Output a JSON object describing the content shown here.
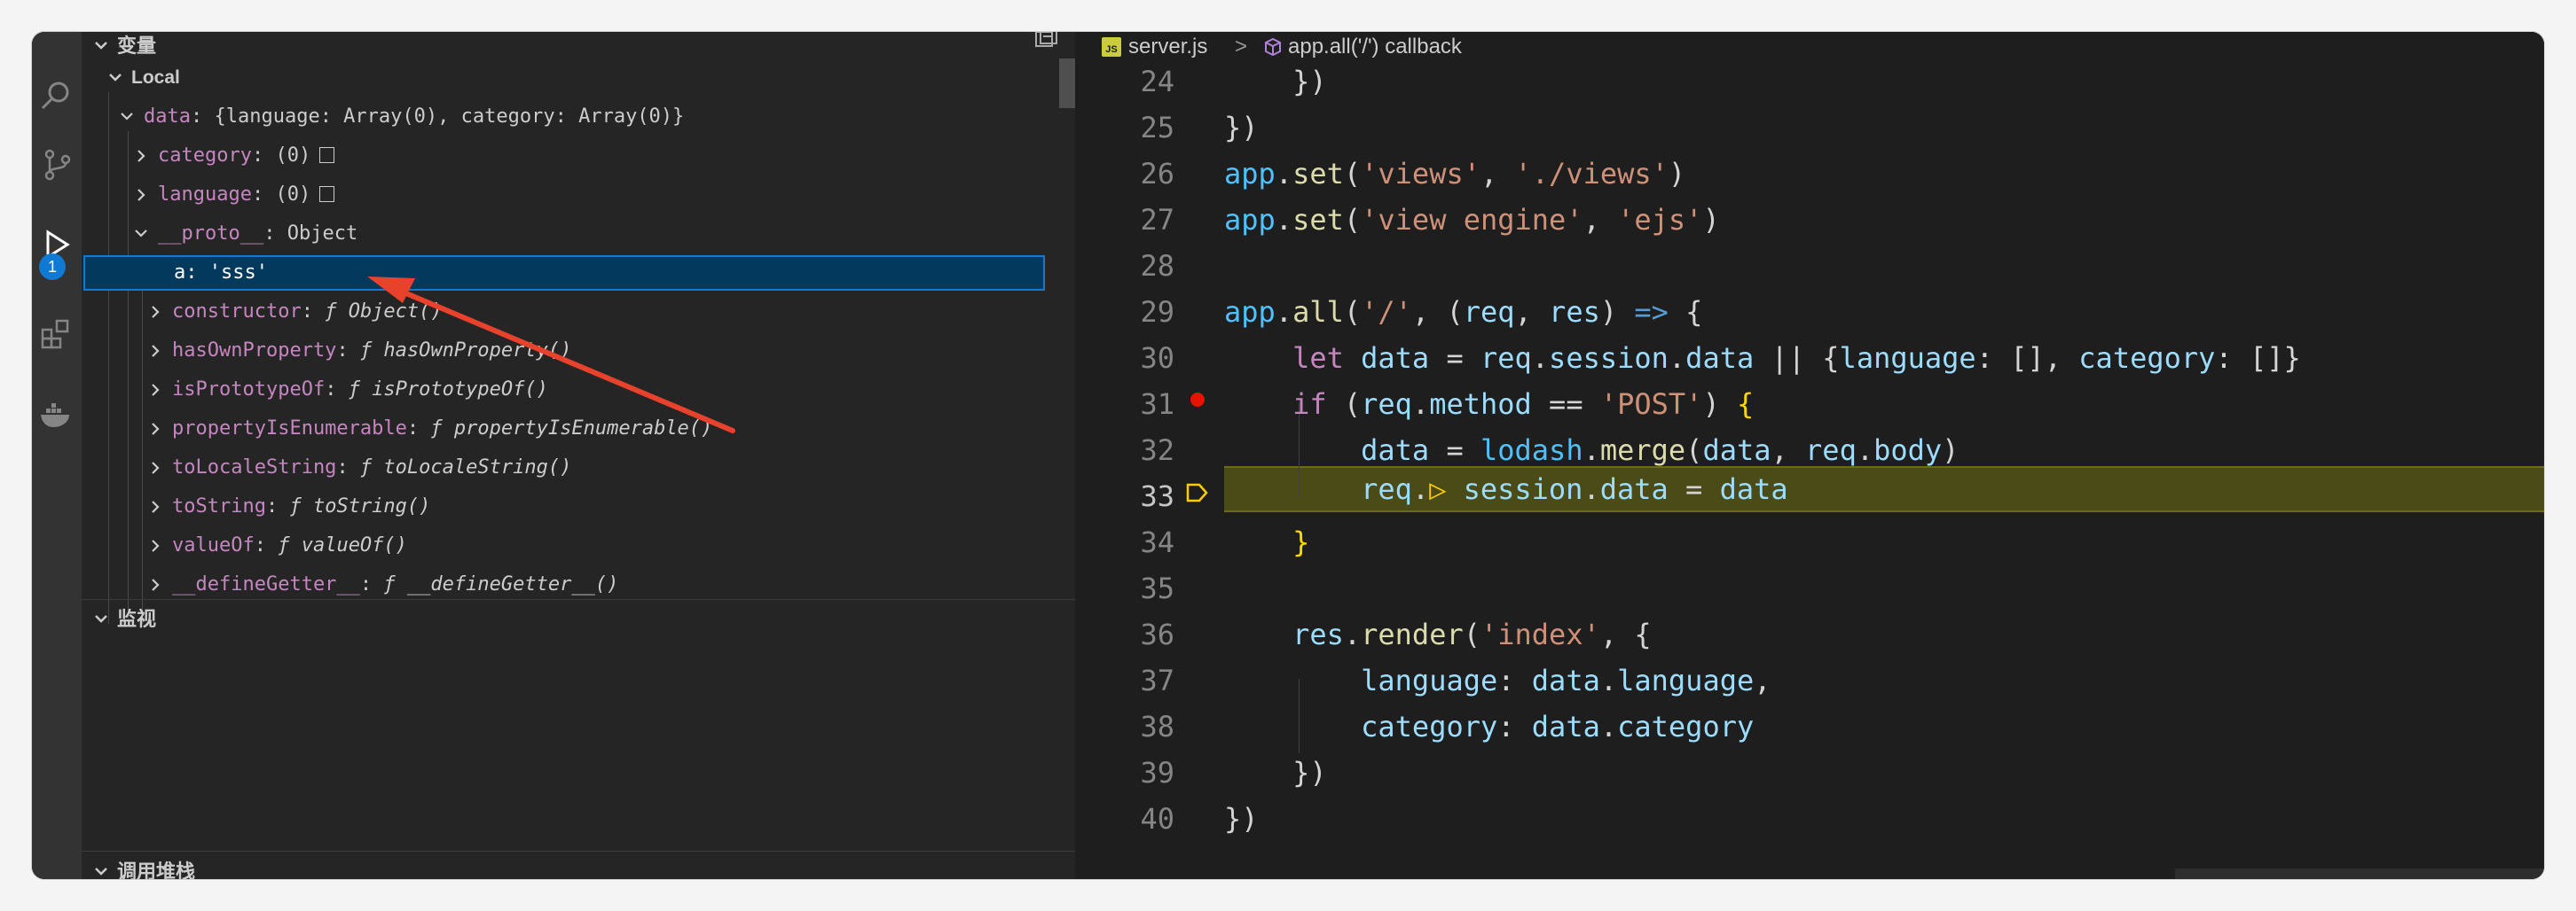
{
  "sidebar": {
    "variables_title": "变量",
    "local_scope": "Local",
    "tree": [
      {
        "key": "data",
        "value": "{language: Array(0), category: Array(0)}"
      },
      {
        "key": "category",
        "value": "(0)"
      },
      {
        "key": "language",
        "value": "(0)"
      },
      {
        "key": "__proto__",
        "value": "Object"
      },
      {
        "key": "a",
        "value": "'sss'"
      },
      {
        "key": "constructor",
        "value": "ƒ Object()"
      },
      {
        "key": "hasOwnProperty",
        "value": "ƒ hasOwnProperty()"
      },
      {
        "key": "isPrototypeOf",
        "value": "ƒ isPrototypeOf()"
      },
      {
        "key": "propertyIsEnumerable",
        "value": "ƒ propertyIsEnumerable()"
      },
      {
        "key": "toLocaleString",
        "value": "ƒ toLocaleString()"
      },
      {
        "key": "toString",
        "value": "ƒ toString()"
      },
      {
        "key": "valueOf",
        "value": "ƒ valueOf()"
      },
      {
        "key": "__defineGetter__",
        "value": "ƒ __defineGetter__()"
      }
    ],
    "watch_title": "监视",
    "callstack_title": "调用堆栈"
  },
  "activity": {
    "debug_badge": "1"
  },
  "editor": {
    "breadcrumb": {
      "file": "server.js",
      "separator": ">",
      "symbol": "app.all('/') callback"
    },
    "line_numbers": [
      "24",
      "25",
      "26",
      "27",
      "28",
      "29",
      "30",
      "31",
      "32",
      "33",
      "34",
      "35",
      "36",
      "37",
      "38",
      "39",
      "40"
    ],
    "current_line": "33",
    "breakpoint_line": "31"
  },
  "colors": {
    "selection": "#04395e",
    "focus_border": "#0e7ad3",
    "current_line_bg": "#4b4b18",
    "breakpoint": "#e51400",
    "annotation_arrow": "#e8412c"
  },
  "icons": [
    "search-icon",
    "source-control-icon",
    "run-debug-icon",
    "extensions-icon",
    "docker-icon",
    "collapse-all-icon",
    "js-file-icon",
    "cube-symbol-icon",
    "breakpoint-icon",
    "current-line-arrow-icon"
  ]
}
